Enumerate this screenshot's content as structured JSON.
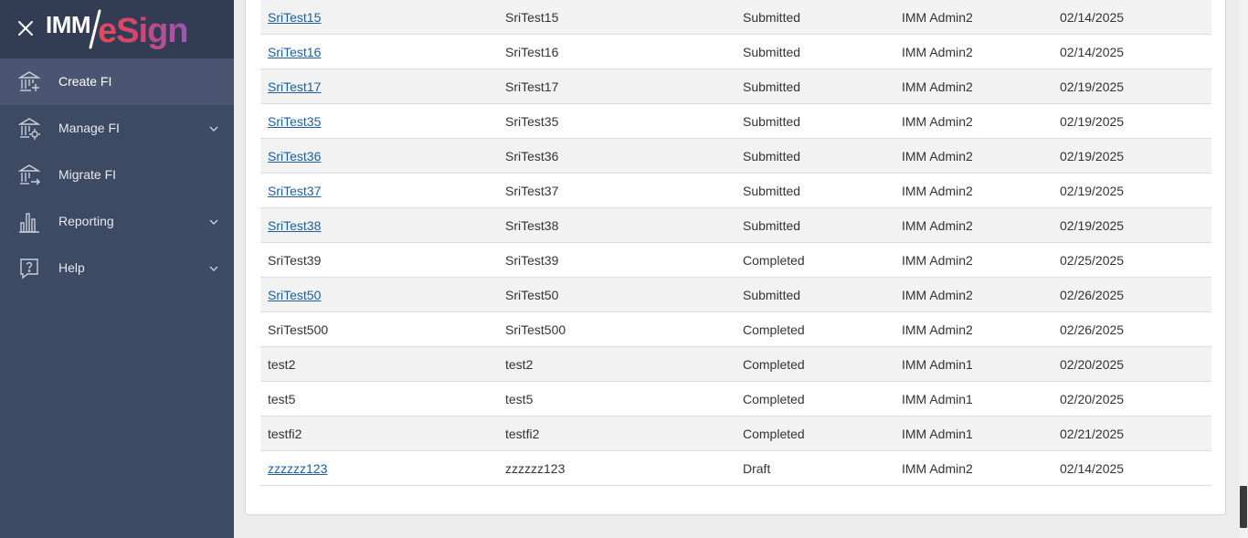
{
  "app": {
    "logo_imm": "IMM",
    "logo_esign": "eSign"
  },
  "sidebar": {
    "items": [
      {
        "label": "Create FI",
        "icon": "bank-add-icon",
        "expandable": false,
        "active": true
      },
      {
        "label": "Manage FI",
        "icon": "bank-settings-icon",
        "expandable": true,
        "active": false
      },
      {
        "label": "Migrate FI",
        "icon": "bank-migrate-icon",
        "expandable": false,
        "active": false
      },
      {
        "label": "Reporting",
        "icon": "bar-chart-icon",
        "expandable": true,
        "active": false
      },
      {
        "label": "Help",
        "icon": "help-icon",
        "expandable": true,
        "active": false
      }
    ]
  },
  "table": {
    "rows": [
      {
        "name": "SriTest15",
        "link": true,
        "display": "SriTest15",
        "status": "Submitted",
        "user": "IMM Admin2",
        "date": "02/14/2025"
      },
      {
        "name": "SriTest16",
        "link": true,
        "display": "SriTest16",
        "status": "Submitted",
        "user": "IMM Admin2",
        "date": "02/14/2025"
      },
      {
        "name": "SriTest17",
        "link": true,
        "display": "SriTest17",
        "status": "Submitted",
        "user": "IMM Admin2",
        "date": "02/19/2025"
      },
      {
        "name": "SriTest35",
        "link": true,
        "display": "SriTest35",
        "status": "Submitted",
        "user": "IMM Admin2",
        "date": "02/19/2025"
      },
      {
        "name": "SriTest36",
        "link": true,
        "display": "SriTest36",
        "status": "Submitted",
        "user": "IMM Admin2",
        "date": "02/19/2025"
      },
      {
        "name": "SriTest37",
        "link": true,
        "display": "SriTest37",
        "status": "Submitted",
        "user": "IMM Admin2",
        "date": "02/19/2025"
      },
      {
        "name": "SriTest38",
        "link": true,
        "display": "SriTest38",
        "status": "Submitted",
        "user": "IMM Admin2",
        "date": "02/19/2025"
      },
      {
        "name": "SriTest39",
        "link": false,
        "display": "SriTest39",
        "status": "Completed",
        "user": "IMM Admin2",
        "date": "02/25/2025"
      },
      {
        "name": "SriTest50",
        "link": true,
        "display": "SriTest50",
        "status": "Submitted",
        "user": "IMM Admin2",
        "date": "02/26/2025"
      },
      {
        "name": "SriTest500",
        "link": false,
        "display": "SriTest500",
        "status": "Completed",
        "user": "IMM Admin2",
        "date": "02/26/2025"
      },
      {
        "name": "test2",
        "link": false,
        "display": "test2",
        "status": "Completed",
        "user": "IMM Admin1",
        "date": "02/20/2025"
      },
      {
        "name": "test5",
        "link": false,
        "display": "test5",
        "status": "Completed",
        "user": "IMM Admin1",
        "date": "02/20/2025"
      },
      {
        "name": "testfi2",
        "link": false,
        "display": "testfi2",
        "status": "Completed",
        "user": "IMM Admin1",
        "date": "02/21/2025"
      },
      {
        "name": "zzzzzz123",
        "link": true,
        "display": "zzzzzz123",
        "status": "Draft",
        "user": "IMM Admin2",
        "date": "02/14/2025"
      }
    ]
  }
}
